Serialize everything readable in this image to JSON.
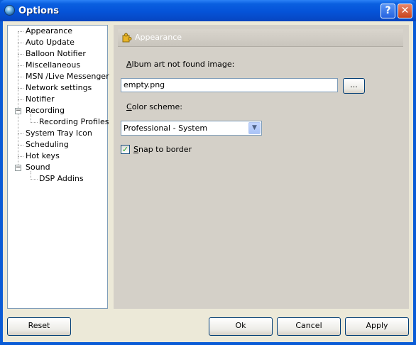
{
  "window": {
    "title": "Options",
    "help_label": "?",
    "close_label": "✕"
  },
  "tree": {
    "items": [
      {
        "label": "Appearance"
      },
      {
        "label": "Auto Update"
      },
      {
        "label": "Balloon Notifier"
      },
      {
        "label": "Miscellaneous"
      },
      {
        "label": "MSN /Live Messenger"
      },
      {
        "label": "Network settings"
      },
      {
        "label": "Notifier"
      },
      {
        "label": "Recording"
      },
      {
        "label": "Recording Profiles"
      },
      {
        "label": "System Tray Icon"
      },
      {
        "label": "Scheduling"
      },
      {
        "label": "Hot keys"
      },
      {
        "label": "Sound"
      },
      {
        "label": "DSP Addins"
      }
    ],
    "expander_symbol": "−"
  },
  "panel": {
    "header": "Appearance",
    "album_art_label_key": "A",
    "album_art_label_rest": "lbum art not found image:",
    "album_art_value": "empty.png",
    "browse_label": "...",
    "color_scheme_label_key": "C",
    "color_scheme_label_rest": "olor scheme:",
    "color_scheme_value": "Professional - System",
    "combo_arrow": "▼",
    "snap_label_key": "S",
    "snap_label_rest": "nap to border",
    "snap_checked_mark": "✓"
  },
  "buttons": {
    "reset": "Reset",
    "ok": "Ok",
    "cancel": "Cancel",
    "apply": "Apply"
  },
  "colors": {
    "titlebar": "#0553D8",
    "panel_background": "#D4D0C8",
    "header_bar": "#C9C5BD"
  }
}
